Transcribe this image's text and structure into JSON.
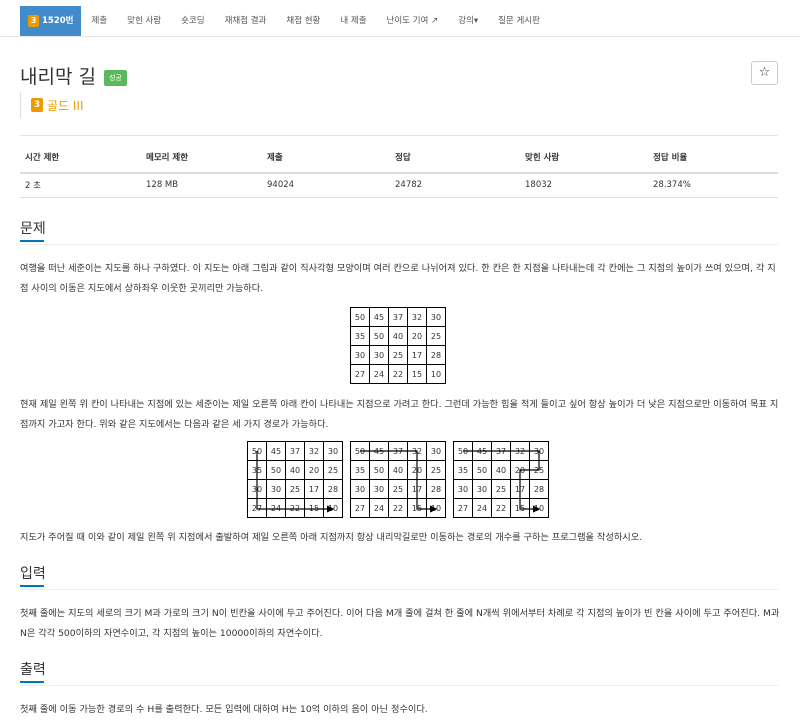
{
  "nav": {
    "problem_id": "1520번",
    "tier_number": "3",
    "items": [
      "제출",
      "맞힌 사람",
      "숏코딩",
      "재채점 결과",
      "채점 현황",
      "내 제출",
      "난이도 기여 ↗",
      "강의▾",
      "질문 게시판"
    ]
  },
  "problem": {
    "title": "내리막 길",
    "status": "성공",
    "star_icon": "☆",
    "tier_label": "골드 III",
    "tier_number": "3"
  },
  "info": {
    "headers": [
      "시간 제한",
      "메모리 제한",
      "제출",
      "정답",
      "맞힌 사람",
      "정답 비율"
    ],
    "values": [
      "2 초",
      "128 MB",
      "94024",
      "24782",
      "18032",
      "28.374%"
    ]
  },
  "sections": {
    "description_title": "문제",
    "description_p1": "여행을 떠난 세준이는 지도를 하나 구하였다. 이 지도는 아래 그림과 같이 직사각형 모양이며 여러 칸으로 나뉘어져 있다. 한 칸은 한 지점을 나타내는데 각 칸에는 그 지점의 높이가 쓰여 있으며, 각 지점 사이의 이동은 지도에서 상하좌우 이웃한 곳끼리만 가능하다.",
    "description_p2": "현재 제일 왼쪽 위 칸이 나타내는 지점에 있는 세준이는 제일 오른쪽 아래 칸이 나타내는 지점으로 가려고 한다. 그런데 가능한 힘을 적게 들이고 싶어 항상 높이가 더 낮은 지점으로만 이동하여 목표 지점까지 가고자 한다. 위와 같은 지도에서는 다음과 같은 세 가지 경로가 가능하다.",
    "description_p3": "지도가 주어질 때 이와 같이 제일 왼쪽 위 지점에서 출발하여 제일 오른쪽 아래 지점까지 항상 내리막길로만 이동하는 경로의 개수를 구하는 프로그램을 작성하시오.",
    "input_title": "입력",
    "input_text": "첫째 줄에는 지도의 세로의 크기 M과 가로의 크기 N이 빈칸을 사이에 두고 주어진다. 이어 다음 M개 줄에 걸쳐 한 줄에 N개씩 위에서부터 차례로 각 지점의 높이가 빈 칸을 사이에 두고 주어진다. M과 N은 각각 500이하의 자연수이고, 각 지점의 높이는 10000이하의 자연수이다.",
    "output_title": "출력",
    "output_text": "첫째 줄에 이동 가능한 경로의 수 H를 출력한다. 모든 입력에 대하여 H는 10억 이하의 음이 아닌 정수이다."
  },
  "map": [
    [
      "50",
      "45",
      "37",
      "32",
      "30"
    ],
    [
      "35",
      "50",
      "40",
      "20",
      "25"
    ],
    [
      "30",
      "30",
      "25",
      "17",
      "28"
    ],
    [
      "27",
      "24",
      "22",
      "15",
      "10"
    ]
  ],
  "colors": {
    "accent": "#428bca",
    "tier": "#ec9a00",
    "success": "#5cb85c",
    "section_underline": "#0076c0"
  }
}
